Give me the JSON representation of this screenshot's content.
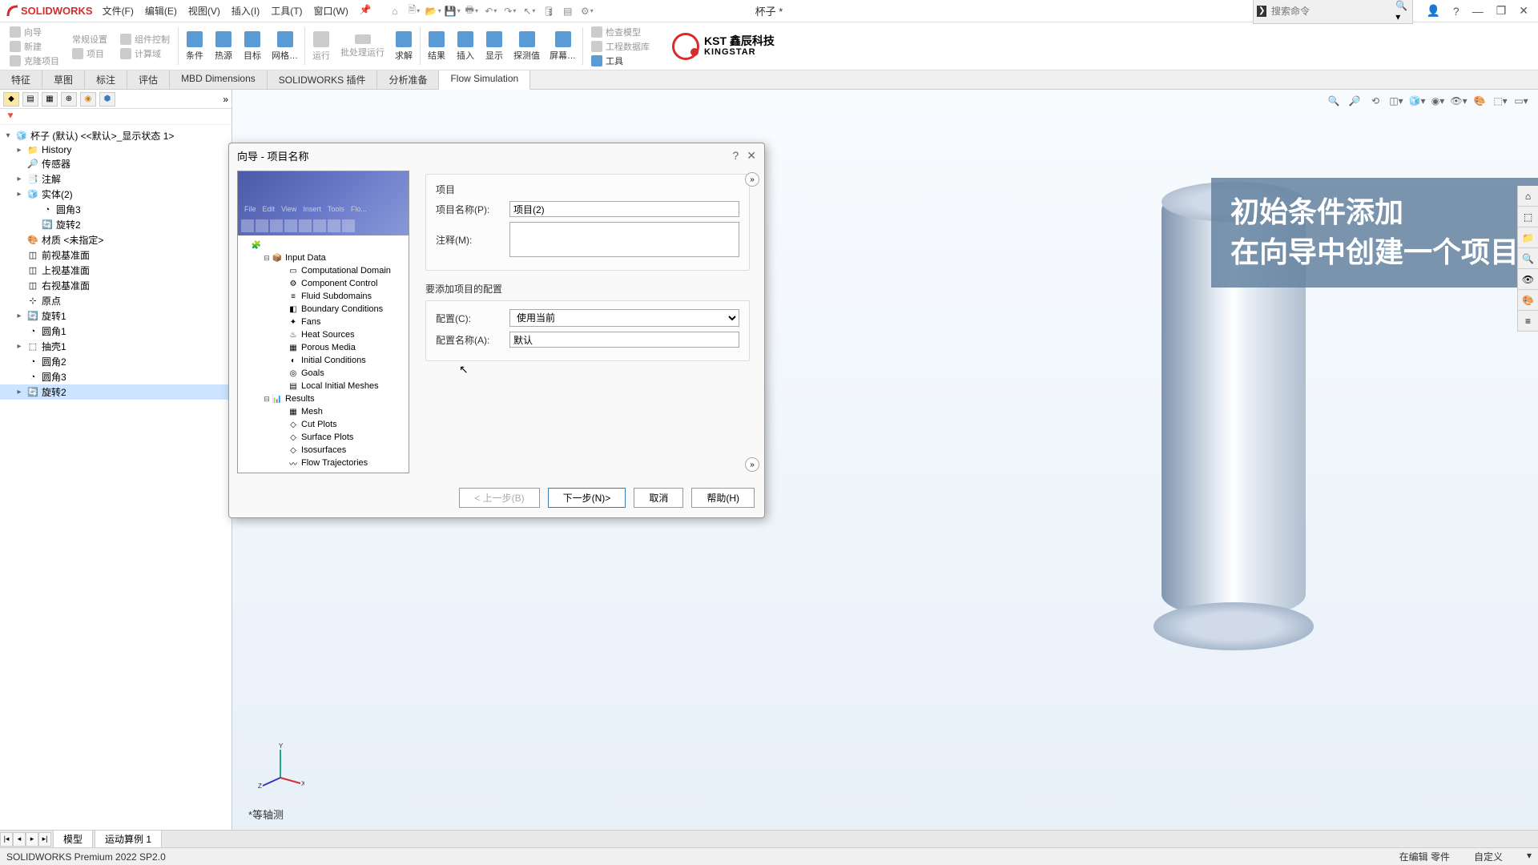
{
  "app": {
    "logo": "SOLIDWORKS",
    "title": "杯子 *"
  },
  "menu": [
    "文件(F)",
    "编辑(E)",
    "视图(V)",
    "插入(I)",
    "工具(T)",
    "窗口(W)"
  ],
  "search_placeholder": "搜索命令",
  "ribbon_left": [
    {
      "label": "向导",
      "enabled": false
    },
    {
      "label": "新建",
      "enabled": false
    },
    {
      "label": "克隆项目",
      "enabled": false
    }
  ],
  "ribbon_left2": [
    {
      "label": "常规设置",
      "enabled": false
    },
    {
      "label": "项目",
      "enabled": false
    }
  ],
  "ribbon_left3": [
    {
      "label": "组件控制",
      "enabled": false
    },
    {
      "label": "计算域",
      "enabled": false
    }
  ],
  "ribbon_main": [
    "条件",
    "热源",
    "目标",
    "网格…"
  ],
  "ribbon_run": [
    "运行",
    "批处理运行"
  ],
  "ribbon_solve": [
    "求解",
    "结果",
    "插入",
    "显示",
    "探测值",
    "屏幕…"
  ],
  "ribbon_right": [
    {
      "label": "检查模型",
      "enabled": false
    },
    {
      "label": "工程数据库",
      "enabled": false
    },
    {
      "label": "工具",
      "enabled": true
    }
  ],
  "kst": {
    "cn": "KST 鑫辰科技",
    "en": "KINGSTAR"
  },
  "tabs": [
    "特征",
    "草图",
    "标注",
    "评估",
    "MBD Dimensions",
    "SOLIDWORKS 插件",
    "分析准备",
    "Flow Simulation"
  ],
  "tree_root": "杯子 (默认) <<默认>_显示状态 1>",
  "tree": [
    {
      "d": 2,
      "exp": "▸",
      "icon": "📁",
      "label": "History"
    },
    {
      "d": 2,
      "exp": "",
      "icon": "🔎",
      "label": "传感器"
    },
    {
      "d": 2,
      "exp": "▸",
      "icon": "📑",
      "label": "注解"
    },
    {
      "d": 2,
      "exp": "▸",
      "icon": "🧊",
      "label": "实体(2)"
    },
    {
      "d": 3,
      "exp": "",
      "icon": "◔",
      "label": "圆角3"
    },
    {
      "d": 3,
      "exp": "",
      "icon": "🔄",
      "label": "旋转2"
    },
    {
      "d": 2,
      "exp": "",
      "icon": "🎨",
      "label": "材质 <未指定>"
    },
    {
      "d": 2,
      "exp": "",
      "icon": "◫",
      "label": "前视基准面"
    },
    {
      "d": 2,
      "exp": "",
      "icon": "◫",
      "label": "上视基准面"
    },
    {
      "d": 2,
      "exp": "",
      "icon": "◫",
      "label": "右视基准面"
    },
    {
      "d": 2,
      "exp": "",
      "icon": "⊹",
      "label": "原点"
    },
    {
      "d": 2,
      "exp": "▸",
      "icon": "🔄",
      "label": "旋转1"
    },
    {
      "d": 2,
      "exp": "",
      "icon": "◔",
      "label": "圆角1"
    },
    {
      "d": 2,
      "exp": "▸",
      "icon": "⬚",
      "label": "抽壳1"
    },
    {
      "d": 2,
      "exp": "",
      "icon": "◔",
      "label": "圆角2"
    },
    {
      "d": 2,
      "exp": "",
      "icon": "◔",
      "label": "圆角3"
    },
    {
      "d": 2,
      "exp": "▸",
      "icon": "🔄",
      "label": "旋转2",
      "selected": true
    }
  ],
  "overlay": {
    "line1": "初始条件添加",
    "line2": "在向导中创建一个项目"
  },
  "view_label": "*等轴测",
  "dialog": {
    "title": "向导 - 项目名称",
    "section1": "项目",
    "project_name_label": "项目名称(P):",
    "project_name_value": "项目(2)",
    "comment_label": "注释(M):",
    "comment_value": "",
    "section2": "要添加项目的配置",
    "config_label": "配置(C):",
    "config_value": "使用当前",
    "config_name_label": "配置名称(A):",
    "config_name_value": "默认",
    "buttons": {
      "back": "< 上一步(B)",
      "next": "下一步(N)>",
      "cancel": "取消",
      "help": "帮助(H)"
    },
    "tree": [
      {
        "d": 1,
        "exp": "",
        "icon": "🧩",
        "label": ""
      },
      {
        "d": 2,
        "exp": "⊟",
        "icon": "📦",
        "label": "Input Data"
      },
      {
        "d": 3,
        "exp": "",
        "icon": "▭",
        "label": "Computational Domain"
      },
      {
        "d": 3,
        "exp": "",
        "icon": "⚙",
        "label": "Component Control"
      },
      {
        "d": 3,
        "exp": "",
        "icon": "≡",
        "label": "Fluid Subdomains"
      },
      {
        "d": 3,
        "exp": "",
        "icon": "◧",
        "label": "Boundary Conditions"
      },
      {
        "d": 3,
        "exp": "",
        "icon": "✦",
        "label": "Fans"
      },
      {
        "d": 3,
        "exp": "",
        "icon": "♨",
        "label": "Heat Sources"
      },
      {
        "d": 3,
        "exp": "",
        "icon": "▦",
        "label": "Porous Media"
      },
      {
        "d": 3,
        "exp": "",
        "icon": "◐",
        "label": "Initial Conditions"
      },
      {
        "d": 3,
        "exp": "",
        "icon": "◎",
        "label": "Goals"
      },
      {
        "d": 3,
        "exp": "",
        "icon": "▤",
        "label": "Local Initial Meshes"
      },
      {
        "d": 2,
        "exp": "⊟",
        "icon": "📊",
        "label": "Results"
      },
      {
        "d": 3,
        "exp": "",
        "icon": "▦",
        "label": "Mesh"
      },
      {
        "d": 3,
        "exp": "",
        "icon": "◇",
        "label": "Cut Plots"
      },
      {
        "d": 3,
        "exp": "",
        "icon": "◇",
        "label": "Surface Plots"
      },
      {
        "d": 3,
        "exp": "",
        "icon": "◇",
        "label": "Isosurfaces"
      },
      {
        "d": 3,
        "exp": "",
        "icon": "〰",
        "label": "Flow Trajectories"
      }
    ]
  },
  "bottom_tabs": [
    "模型",
    "运动算例 1"
  ],
  "status": {
    "left": "SOLIDWORKS Premium 2022 SP2.0",
    "mid": "在编辑 零件",
    "right": "自定义"
  }
}
